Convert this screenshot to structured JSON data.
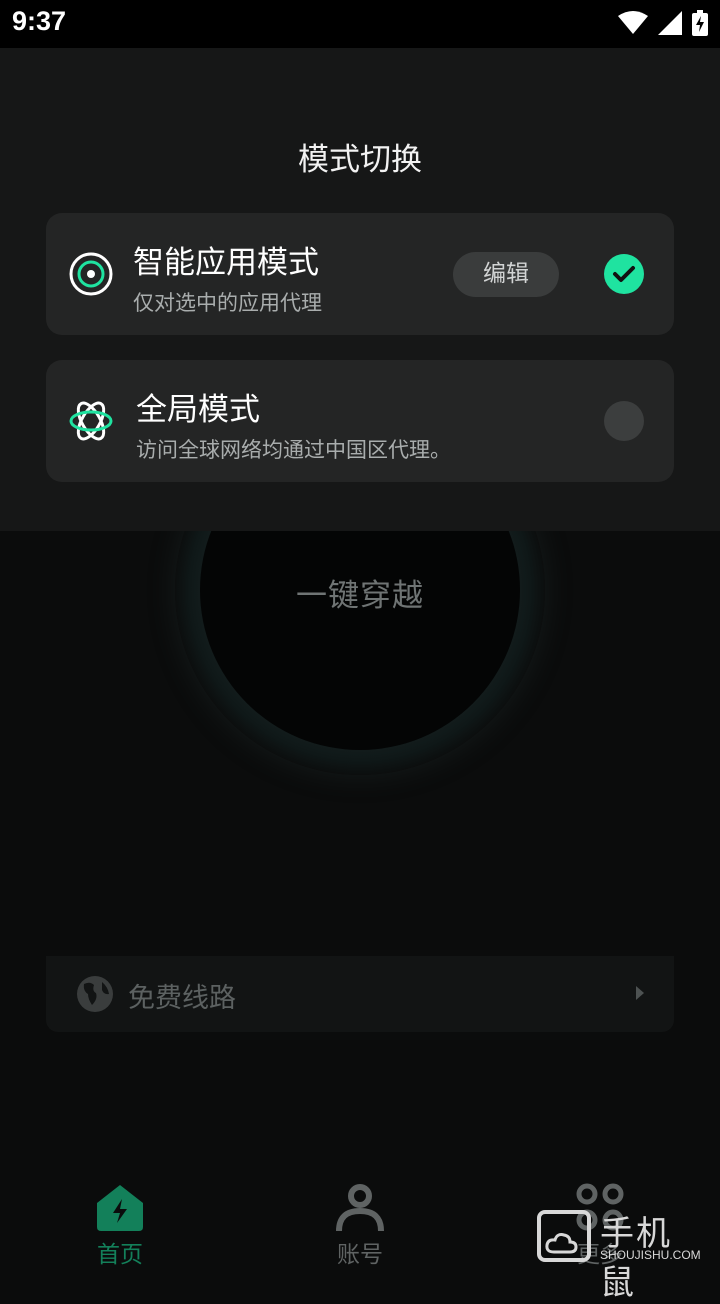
{
  "status_bar": {
    "time": "9:37"
  },
  "sheet": {
    "title": "模式切换",
    "modes": [
      {
        "name": "智能应用模式",
        "desc": "仅对选中的应用代理",
        "edit_label": "编辑",
        "selected": true
      },
      {
        "name": "全局模式",
        "desc": "访问全球网络均通过中国区代理。",
        "selected": false
      }
    ]
  },
  "home": {
    "connect_label": "一键穿越",
    "route_label": "免费线路"
  },
  "bottom_nav": {
    "items": [
      {
        "label": "首页",
        "icon": "home-bolt-icon",
        "active": true
      },
      {
        "label": "账号",
        "icon": "person-icon",
        "active": false
      },
      {
        "label": "更多",
        "icon": "grid-dots-icon",
        "active": false
      }
    ]
  },
  "watermark": {
    "text": "手机鼠",
    "sub": "SHOUJISHU.COM"
  },
  "colors": {
    "accent": "#1fe3a0",
    "nav_active": "#13805a",
    "card_bg": "#242525",
    "sheet_bg": "#161717"
  }
}
